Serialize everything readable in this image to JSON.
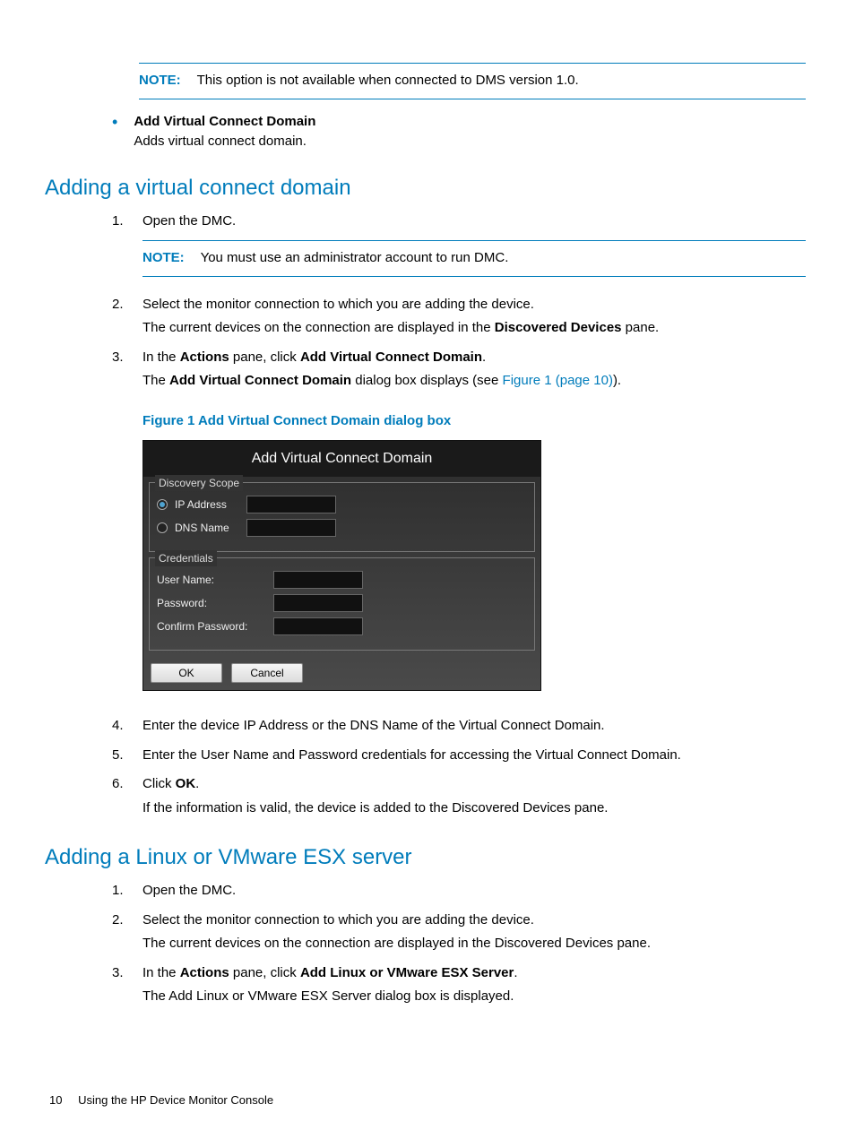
{
  "topNote": {
    "label": "NOTE:",
    "text": "This option is not available when connected to DMS version 1.0."
  },
  "bullet1": {
    "title": "Add Virtual Connect Domain",
    "desc": "Adds virtual connect domain."
  },
  "section1": {
    "heading": "Adding a virtual connect domain",
    "steps": {
      "s1": {
        "num": "1.",
        "t1": "Open the DMC."
      },
      "s1note": {
        "label": "NOTE:",
        "text": "You must use an administrator account to run DMC."
      },
      "s2": {
        "num": "2.",
        "t1": "Select the monitor connection to which you are adding the device.",
        "t2a": "The current devices on the connection are displayed in the ",
        "t2b": "Discovered Devices",
        "t2c": " pane."
      },
      "s3": {
        "num": "3.",
        "t1a": "In the ",
        "t1b": "Actions",
        "t1c": " pane, click ",
        "t1d": "Add Virtual Connect Domain",
        "t1e": ".",
        "t2a": "The ",
        "t2b": "Add Virtual Connect Domain",
        "t2c": " dialog box displays (see ",
        "t2d": "Figure 1 (page 10)",
        "t2e": ")."
      },
      "s4": {
        "num": "4.",
        "t1": "Enter the device IP Address or the DNS Name of the Virtual Connect Domain."
      },
      "s5": {
        "num": "5.",
        "t1": "Enter the User Name and Password credentials for accessing the Virtual Connect Domain."
      },
      "s6": {
        "num": "6.",
        "t1a": "Click ",
        "t1b": "OK",
        "t1c": ".",
        "t2": "If the information is valid, the device is added to the Discovered Devices pane."
      }
    }
  },
  "figure": {
    "caption": "Figure 1 Add Virtual Connect Domain dialog box",
    "dialog": {
      "title": "Add Virtual Connect Domain",
      "scopeLegend": "Discovery Scope",
      "radioIP": "IP Address",
      "radioDNS": "DNS Name",
      "credLegend": "Credentials",
      "userLabel": "User Name:",
      "passLabel": "Password:",
      "confirmLabel": "Confirm Password:",
      "okBtn": "OK",
      "cancelBtn": "Cancel"
    }
  },
  "section2": {
    "heading": "Adding a Linux or VMware ESX server",
    "steps": {
      "s1": {
        "num": "1.",
        "t1": "Open the DMC."
      },
      "s2": {
        "num": "2.",
        "t1": "Select the monitor connection to which you are adding the device.",
        "t2": "The current devices on the connection are displayed in the Discovered Devices pane."
      },
      "s3": {
        "num": "3.",
        "t1a": "In the ",
        "t1b": "Actions",
        "t1c": " pane, click ",
        "t1d": "Add Linux or VMware ESX Server",
        "t1e": ".",
        "t2": "The Add Linux or VMware ESX Server dialog box is displayed."
      }
    }
  },
  "footer": {
    "page": "10",
    "title": "Using the HP Device Monitor Console"
  }
}
